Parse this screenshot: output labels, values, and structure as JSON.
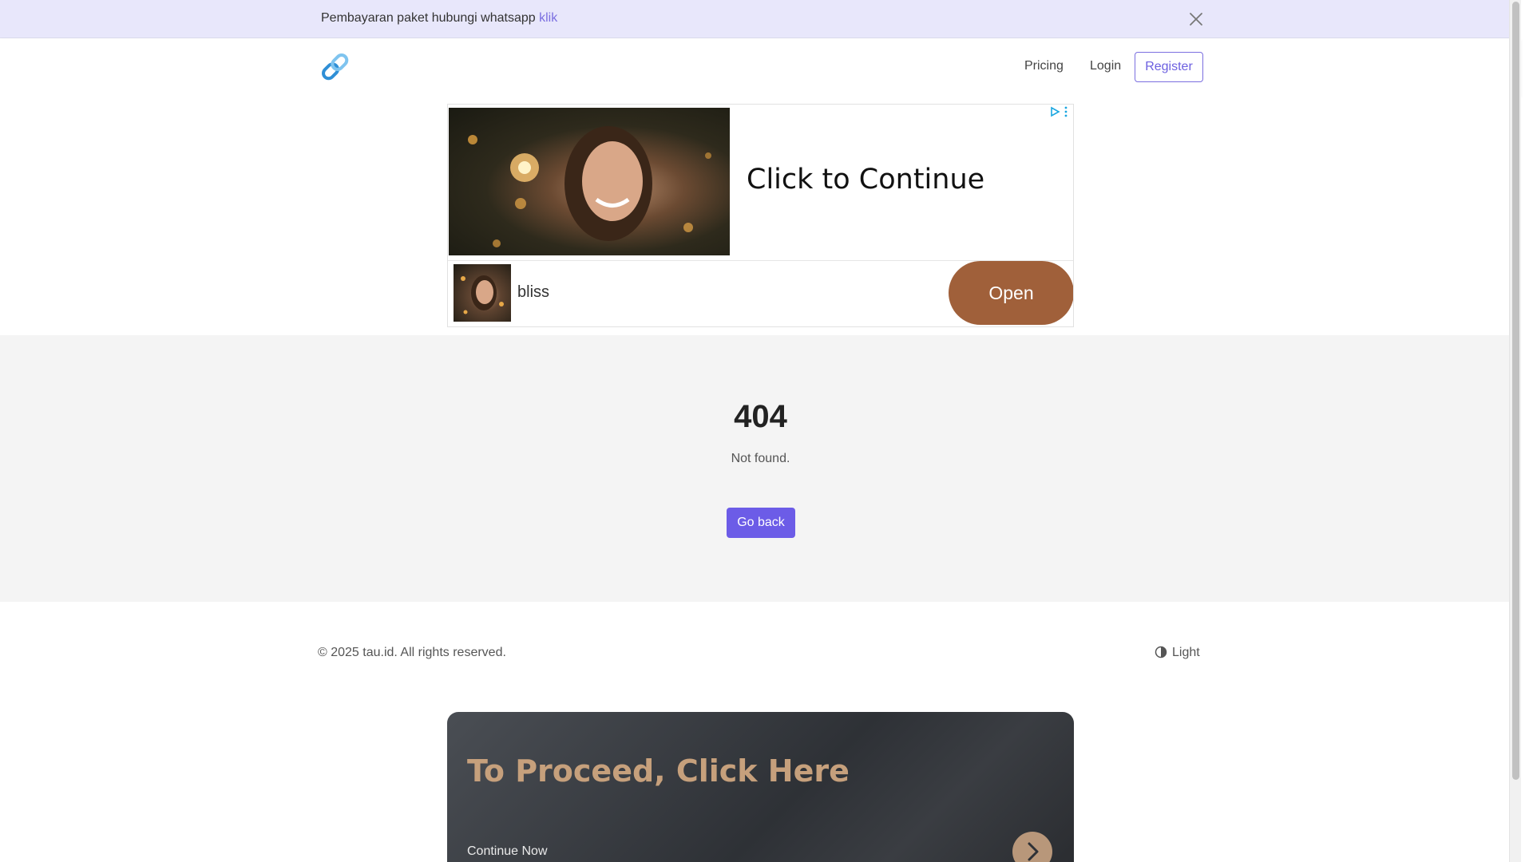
{
  "announcement": {
    "text": "Pembayaran paket hubungi whatsapp ",
    "link": "klik",
    "close_icon": "close-icon"
  },
  "navbar": {
    "logo_icon": "link-icon",
    "pricing": "Pricing",
    "login": "Login",
    "register": "Register"
  },
  "ad": {
    "headline": "Click to Continue",
    "brand": "bliss",
    "open_label": "Open",
    "icons": [
      "adchoices-icon",
      "more-vertical-icon"
    ],
    "button_color": "#a0603a"
  },
  "notfound": {
    "code": "404",
    "message": "Not found.",
    "back_label": "Go back",
    "button_color": "#6c5ce7"
  },
  "footer": {
    "copyright": "© 2025 tau.id. All rights reserved.",
    "theme_label": "Light",
    "theme_icon": "contrast-icon"
  },
  "banner": {
    "title": "To Proceed, Click Here",
    "subtitle": "Continue Now",
    "arrow_icon": "chevron-right-icon",
    "title_color": "#c6a07c"
  },
  "colors": {
    "accent": "#6c5ce7",
    "announcement_bg": "#e8e7fb"
  }
}
